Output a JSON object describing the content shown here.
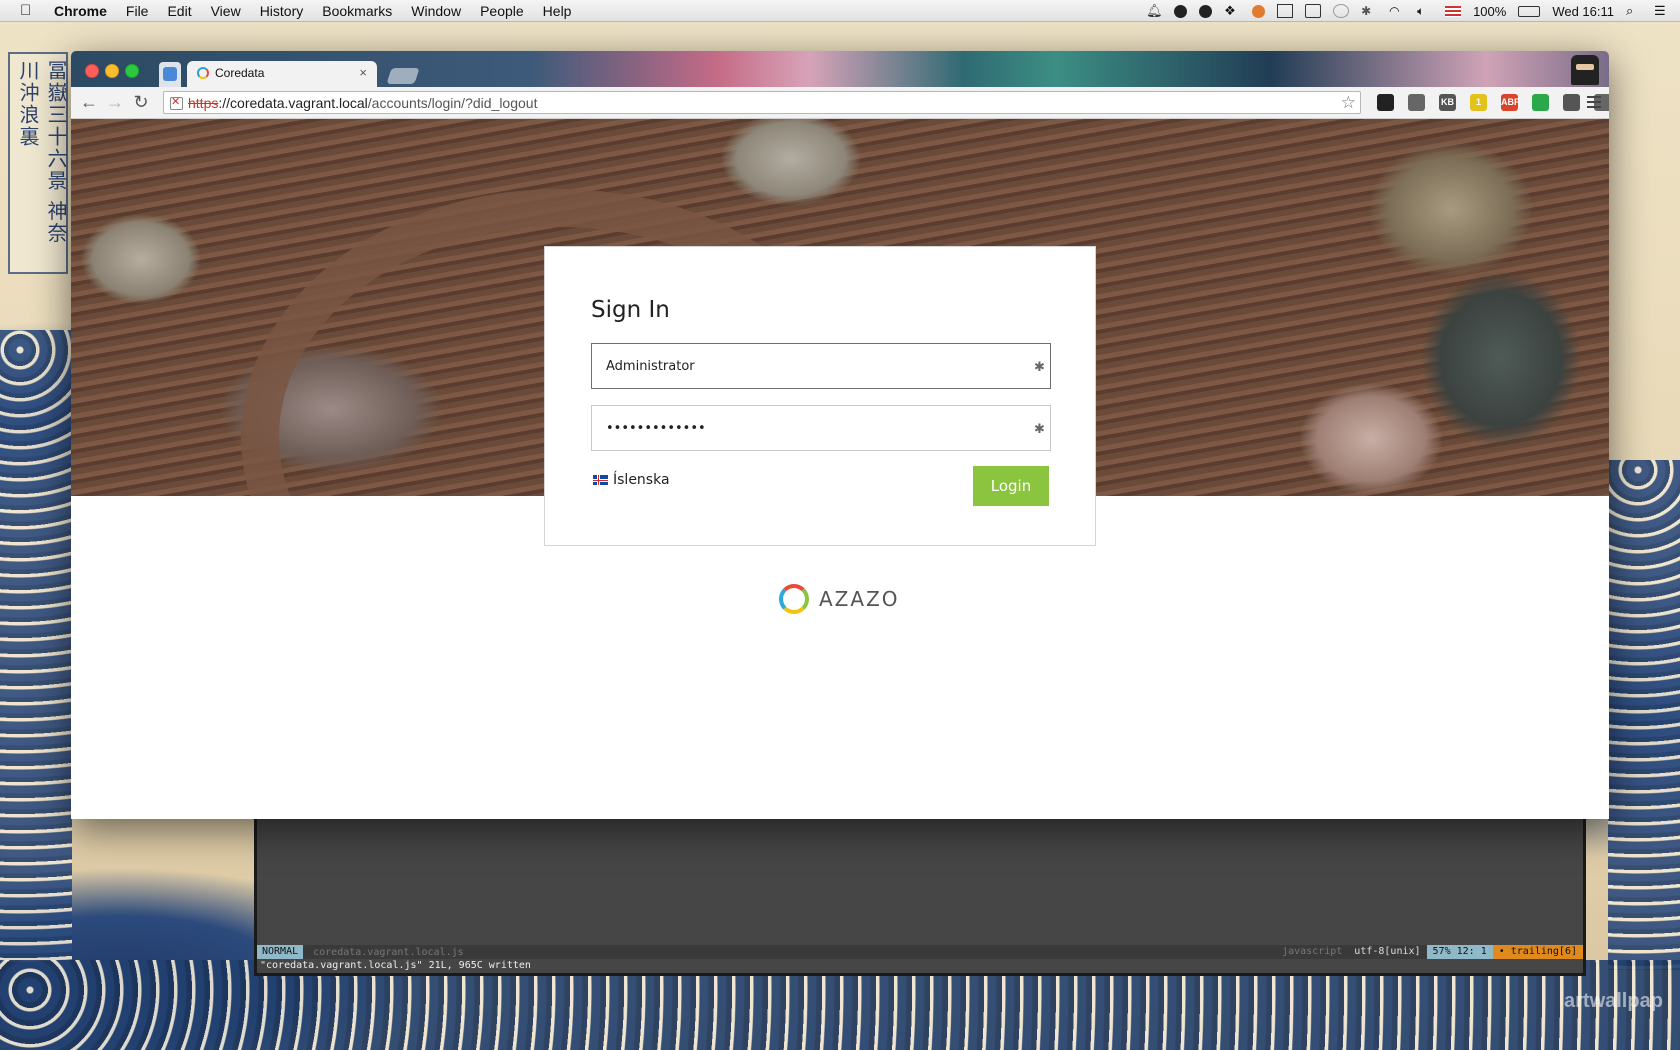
{
  "menubar": {
    "app": "Chrome",
    "items": [
      "File",
      "Edit",
      "View",
      "History",
      "Bookmarks",
      "Window",
      "People",
      "Help"
    ],
    "battery": "100%",
    "clock": "Wed 16:11"
  },
  "wallpaper": {
    "cartouche_text": "冨嶽三十六景 神奈川沖浪裏",
    "watermark": "artwallpap"
  },
  "browser": {
    "tab_title": "Coredata",
    "tab_close": "×",
    "url_scheme": "https",
    "url_host": "://coredata.vagrant.local",
    "url_path": "/accounts/login/?did_logout",
    "extensions": [
      {
        "icon": "github-icon",
        "label": "",
        "color": "#222222"
      },
      {
        "icon": "thumbs-up-icon",
        "label": "",
        "color": "#666666"
      },
      {
        "icon": "kb-icon",
        "label": "KB",
        "color": "#555555"
      },
      {
        "icon": "note-icon",
        "label": "1",
        "color": "#e3c21d"
      },
      {
        "icon": "abp-icon",
        "label": "ABP",
        "color": "#d9442c"
      },
      {
        "icon": "hangouts-icon",
        "label": "",
        "color": "#2aa84a"
      },
      {
        "icon": "pocket-icon",
        "label": "",
        "color": "#555555"
      },
      {
        "icon": "cast-icon",
        "label": "",
        "color": "#666666"
      },
      {
        "icon": "color-icon",
        "label": "",
        "color": "#333333"
      }
    ]
  },
  "login": {
    "heading": "Sign In",
    "username_value": "Administrator",
    "password_value": "•••••••••••••",
    "language": "Íslenska",
    "submit_label": "Login"
  },
  "brand": {
    "name": "AZAZO",
    "colors": {
      "accent": "#8bc53f",
      "blue": "#2aa9df",
      "red": "#e84c3d",
      "yellow": "#f1c40f"
    }
  },
  "vim": {
    "mode": "NORMAL",
    "filename": "coredata.vagrant.local.js",
    "filetype": "javascript",
    "encoding": "utf-8[unix]",
    "position": "57%  12:  1",
    "trailing": "• trailing[6]",
    "message": "\"coredata.vagrant.local.js\" 21L, 965C written"
  }
}
